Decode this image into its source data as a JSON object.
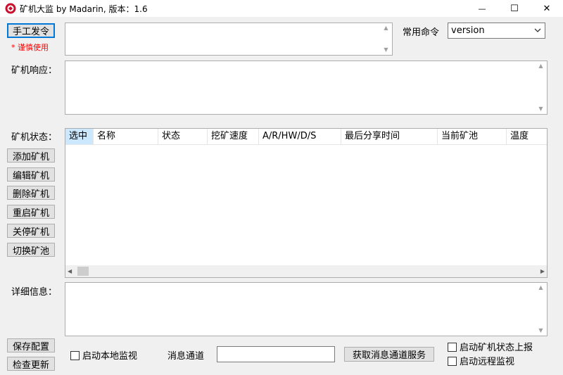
{
  "window": {
    "title": "矿机大监 by Madarin, 版本：1.6",
    "minimize_glyph": "—",
    "maximize_glyph": "☐",
    "close_glyph": "✕"
  },
  "manual": {
    "button_label": "手工发令",
    "warning": "* 谨慎使用",
    "command_value": ""
  },
  "common_commands": {
    "label": "常用命令",
    "selected": "version"
  },
  "response": {
    "label": "矿机响应：",
    "value": ""
  },
  "miner_status": {
    "label": "矿机状态：",
    "columns": [
      "选中",
      "名称",
      "状态",
      "挖矿速度",
      "A/R/HW/D/S",
      "最后分享时间",
      "当前矿池",
      "温度"
    ],
    "rows": []
  },
  "actions": {
    "add": "添加矿机",
    "edit": "编辑矿机",
    "delete": "删除矿机",
    "restart": "重启矿机",
    "stop": "关停矿机",
    "switch_pool": "切换矿池"
  },
  "details": {
    "label": "详细信息：",
    "value": ""
  },
  "bottom": {
    "save_config": "保存配置",
    "check_update": "检查更新",
    "local_monitor": "启动本地监视",
    "channel_label": "消息通道",
    "channel_value": "",
    "get_channel_service": "获取消息通道服务",
    "report_status": "启动矿机状态上报",
    "remote_monitor": "启动远程监视"
  }
}
